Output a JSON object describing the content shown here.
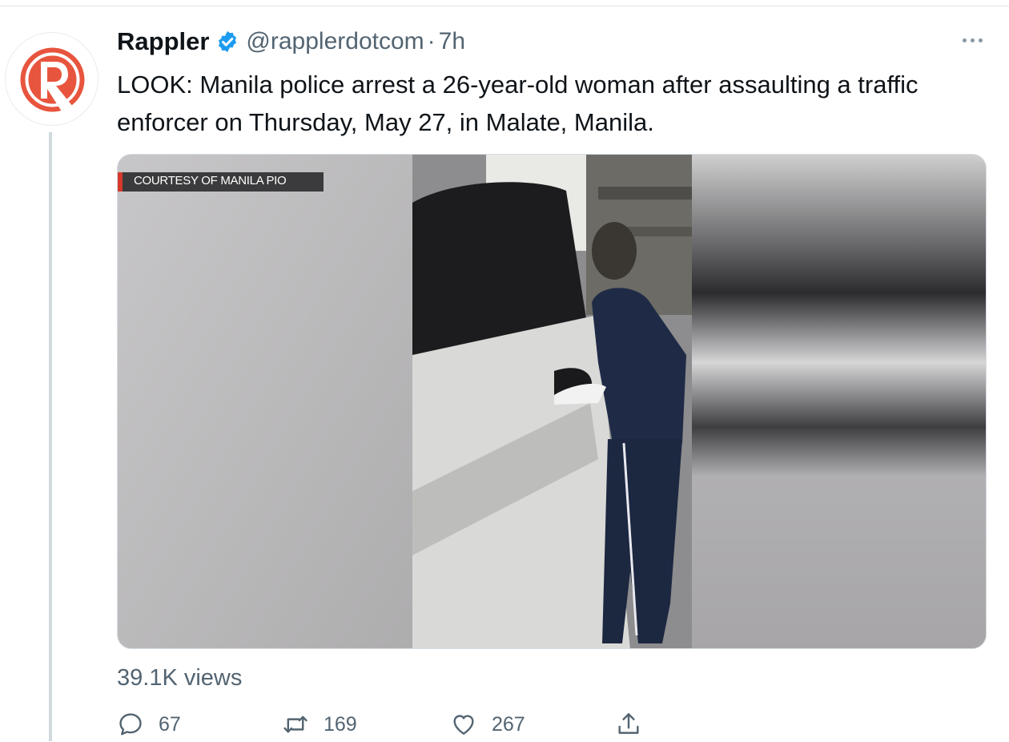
{
  "tweet": {
    "display_name": "Rappler",
    "handle": "@rapplerdotcom",
    "separator": "·",
    "time": "7h",
    "text": "LOOK: Manila police arrest a 26-year-old woman after assaulting a traffic enforcer on Thursday, May 27, in Malate, Manila.",
    "media": {
      "caption": "COURTESY OF MANILA PIO",
      "kind": "video-thumbnail"
    },
    "views": "39.1K views",
    "actions": {
      "replies": "67",
      "retweets": "169",
      "likes": "267"
    }
  },
  "icons": {
    "avatar": "rappler-logo",
    "verified": "verified-badge-icon",
    "more": "more-options-icon",
    "reply": "reply-icon",
    "retweet": "retweet-icon",
    "like": "heart-icon",
    "share": "share-icon"
  },
  "colors": {
    "brand": "#e8553e",
    "verified": "#1d9bf0",
    "secondary_text": "#536471",
    "caption_accent": "#d6392c"
  }
}
